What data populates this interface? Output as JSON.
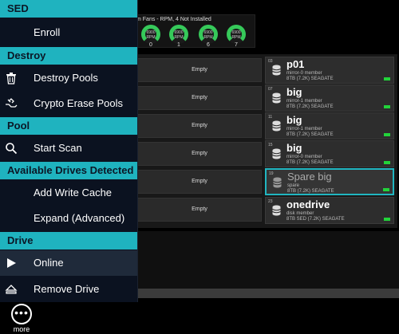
{
  "fans": {
    "title": "m Fans - RPM, 4 Not Installed",
    "rpm_label": "RPM",
    "units": [
      {
        "rpm": "6900",
        "index": "0"
      },
      {
        "rpm": "6900",
        "index": "1"
      },
      {
        "rpm": "6900",
        "index": "6"
      },
      {
        "rpm": "6900",
        "index": "7"
      }
    ]
  },
  "drive_slots": {
    "left": [
      {
        "label": "Empty"
      },
      {
        "label": "Empty"
      },
      {
        "label": "Empty"
      },
      {
        "label": "Empty"
      },
      {
        "label": "Empty"
      },
      {
        "label": "Empty"
      }
    ],
    "right": [
      {
        "slot": "03",
        "name": "p01",
        "role": "mirror-0 member",
        "spec": "8TB (7.2K) SEAGATE",
        "led_color": "#22d33a",
        "selected": false
      },
      {
        "slot": "07",
        "name": "big",
        "role": "mirror-1 member",
        "spec": "8TB (7.2K) SEAGATE",
        "led_color": "#22d33a",
        "selected": false
      },
      {
        "slot": "11",
        "name": "big",
        "role": "mirror-1 member",
        "spec": "8TB (7.2K) SEAGATE",
        "led_color": "#22d33a",
        "selected": false
      },
      {
        "slot": "15",
        "name": "big",
        "role": "mirror-0 member",
        "spec": "8TB (7.2K) SEAGATE",
        "led_color": "#22d33a",
        "selected": false
      },
      {
        "slot": "19",
        "name": "Spare big",
        "role": "spare",
        "spec": "8TB (7.2K) SEAGATE",
        "led_color": "#22d33a",
        "selected": true
      },
      {
        "slot": "23",
        "name": "onedrive",
        "role": "disk member",
        "spec": "8TB SED (7.2K) SEAGATE",
        "led_color": "#22d33a",
        "selected": false
      }
    ]
  },
  "menu": {
    "sections": [
      {
        "title": "SED",
        "items": [
          {
            "label": "Enroll",
            "icon": ""
          }
        ]
      },
      {
        "title": "Destroy",
        "items": [
          {
            "label": "Destroy Pools",
            "icon": "trash-icon"
          },
          {
            "label": "Crypto Erase Pools",
            "icon": "key-hand-icon"
          }
        ]
      },
      {
        "title": "Pool",
        "items": [
          {
            "label": "Start Scan",
            "icon": "search-icon"
          }
        ]
      },
      {
        "title": "Available Drives Detected",
        "items": [
          {
            "label": "Add Write Cache",
            "icon": ""
          },
          {
            "label": "Expand (Advanced)",
            "icon": ""
          }
        ]
      },
      {
        "title": "Drive",
        "items": [
          {
            "label": "Online",
            "icon": "play-icon"
          },
          {
            "label": "Remove Drive",
            "icon": "eject-icon"
          }
        ]
      }
    ]
  },
  "more": {
    "label": "more",
    "icon": "ellipsis-icon"
  },
  "colors": {
    "accent": "#1fb3bf",
    "menu_bg": "#0b1220",
    "led_green": "#22d33a",
    "fan_green": "#36c95a"
  }
}
